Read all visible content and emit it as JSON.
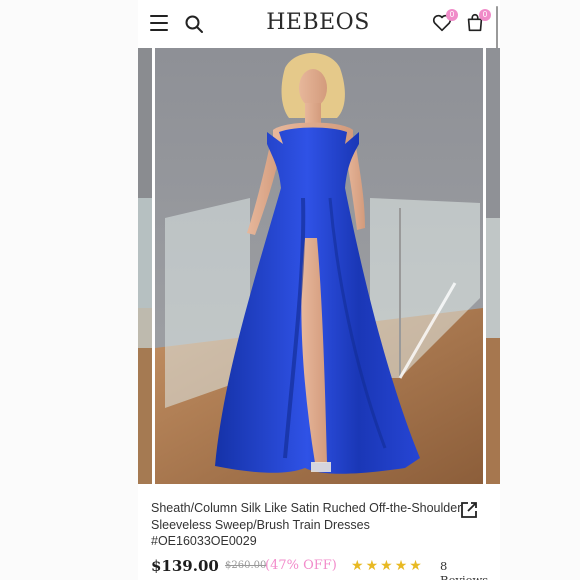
{
  "header": {
    "logo": "HEBEOS",
    "wishlist_count": "0",
    "cart_count": "0"
  },
  "product": {
    "title_line1": "Sheath/Column Silk Like Satin Ruched Off-the-Shoulder",
    "title_line2": "Sleeveless Sweep/Brush Train Dresses",
    "sku": "#OE16033OE0029",
    "price": "$139.00",
    "original_price": "$260.00",
    "discount": "(47% OFF)",
    "rating": 5,
    "reviews": "8 Reviews"
  },
  "colors": {
    "accent_pink": "#f08cc9",
    "dress_blue": "#1f3fcf",
    "star": "#e8b923"
  },
  "icons": [
    "menu-icon",
    "search-icon",
    "heart-icon",
    "cart-icon",
    "share-icon",
    "star-icon"
  ]
}
